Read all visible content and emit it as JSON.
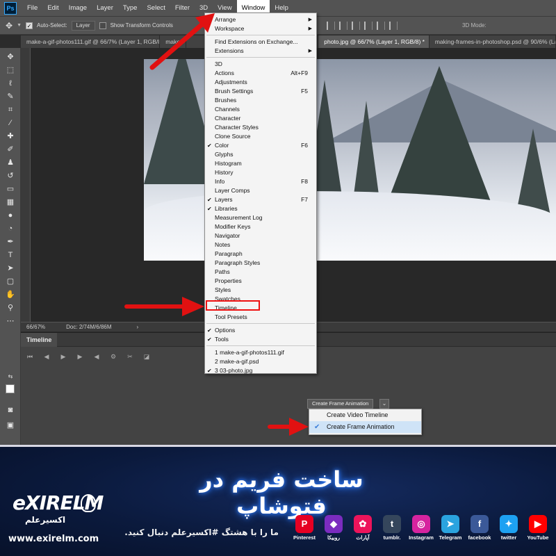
{
  "app": {
    "logo": "Ps",
    "menus": [
      "File",
      "Edit",
      "Image",
      "Layer",
      "Type",
      "Select",
      "Filter",
      "3D",
      "View",
      "Window",
      "Help"
    ],
    "active_menu": "Window"
  },
  "options_bar": {
    "auto_select_label": "Auto-Select:",
    "auto_select_value": "Layer",
    "show_transform_label": "Show Transform Controls",
    "mode_3d_label": "3D Mode:"
  },
  "doc_tabs": [
    {
      "label": "make-a-gif-photos111.gif @ 66/7% (Layer 1, RGB/8) *"
    },
    {
      "label": "make"
    },
    {
      "label": "photo.jpg @ 66/7% (Layer 1, RGB/8) *"
    },
    {
      "label": "making-frames-in-photoshop.psd @ 90/6% (Layer 1, R"
    }
  ],
  "status_bar": {
    "zoom": "66/67%",
    "doc_info": "Doc: 2/74M/6/86M"
  },
  "timeline": {
    "title": "Timeline",
    "create_button": "Create Frame Animation",
    "dropdown_options": [
      {
        "label": "Create Video Timeline",
        "selected": false
      },
      {
        "label": "Create Frame Animation",
        "selected": true
      }
    ]
  },
  "window_menu": {
    "items": [
      {
        "label": "Arrange",
        "shortcut": "",
        "checked": false,
        "submenu": true,
        "sep_after": false
      },
      {
        "label": "Workspace",
        "shortcut": "",
        "checked": false,
        "submenu": true,
        "sep_after": true
      },
      {
        "label": "Find Extensions on Exchange...",
        "shortcut": "",
        "checked": false,
        "submenu": false,
        "sep_after": false
      },
      {
        "label": "Extensions",
        "shortcut": "",
        "checked": false,
        "submenu": true,
        "sep_after": true
      },
      {
        "label": "3D",
        "shortcut": "",
        "checked": false,
        "submenu": false,
        "sep_after": false
      },
      {
        "label": "Actions",
        "shortcut": "Alt+F9",
        "checked": false,
        "submenu": false,
        "sep_after": false
      },
      {
        "label": "Adjustments",
        "shortcut": "",
        "checked": false,
        "submenu": false,
        "sep_after": false
      },
      {
        "label": "Brush Settings",
        "shortcut": "F5",
        "checked": false,
        "submenu": false,
        "sep_after": false
      },
      {
        "label": "Brushes",
        "shortcut": "",
        "checked": false,
        "submenu": false,
        "sep_after": false
      },
      {
        "label": "Channels",
        "shortcut": "",
        "checked": false,
        "submenu": false,
        "sep_after": false
      },
      {
        "label": "Character",
        "shortcut": "",
        "checked": false,
        "submenu": false,
        "sep_after": false
      },
      {
        "label": "Character Styles",
        "shortcut": "",
        "checked": false,
        "submenu": false,
        "sep_after": false
      },
      {
        "label": "Clone Source",
        "shortcut": "",
        "checked": false,
        "submenu": false,
        "sep_after": false
      },
      {
        "label": "Color",
        "shortcut": "F6",
        "checked": true,
        "submenu": false,
        "sep_after": false
      },
      {
        "label": "Glyphs",
        "shortcut": "",
        "checked": false,
        "submenu": false,
        "sep_after": false
      },
      {
        "label": "Histogram",
        "shortcut": "",
        "checked": false,
        "submenu": false,
        "sep_after": false
      },
      {
        "label": "History",
        "shortcut": "",
        "checked": false,
        "submenu": false,
        "sep_after": false
      },
      {
        "label": "Info",
        "shortcut": "F8",
        "checked": false,
        "submenu": false,
        "sep_after": false
      },
      {
        "label": "Layer Comps",
        "shortcut": "",
        "checked": false,
        "submenu": false,
        "sep_after": false
      },
      {
        "label": "Layers",
        "shortcut": "F7",
        "checked": true,
        "submenu": false,
        "sep_after": false
      },
      {
        "label": "Libraries",
        "shortcut": "",
        "checked": true,
        "submenu": false,
        "sep_after": false
      },
      {
        "label": "Measurement Log",
        "shortcut": "",
        "checked": false,
        "submenu": false,
        "sep_after": false
      },
      {
        "label": "Modifier Keys",
        "shortcut": "",
        "checked": false,
        "submenu": false,
        "sep_after": false
      },
      {
        "label": "Navigator",
        "shortcut": "",
        "checked": false,
        "submenu": false,
        "sep_after": false
      },
      {
        "label": "Notes",
        "shortcut": "",
        "checked": false,
        "submenu": false,
        "sep_after": false
      },
      {
        "label": "Paragraph",
        "shortcut": "",
        "checked": false,
        "submenu": false,
        "sep_after": false
      },
      {
        "label": "Paragraph Styles",
        "shortcut": "",
        "checked": false,
        "submenu": false,
        "sep_after": false
      },
      {
        "label": "Paths",
        "shortcut": "",
        "checked": false,
        "submenu": false,
        "sep_after": false
      },
      {
        "label": "Properties",
        "shortcut": "",
        "checked": false,
        "submenu": false,
        "sep_after": false
      },
      {
        "label": "Styles",
        "shortcut": "",
        "checked": false,
        "submenu": false,
        "sep_after": false
      },
      {
        "label": "Swatches",
        "shortcut": "",
        "checked": false,
        "submenu": false,
        "sep_after": false
      },
      {
        "label": "Timeline",
        "shortcut": "",
        "checked": false,
        "submenu": false,
        "sep_after": false
      },
      {
        "label": "Tool Presets",
        "shortcut": "",
        "checked": false,
        "submenu": false,
        "sep_after": true
      },
      {
        "label": "Options",
        "shortcut": "",
        "checked": true,
        "submenu": false,
        "sep_after": false
      },
      {
        "label": "Tools",
        "shortcut": "",
        "checked": true,
        "submenu": false,
        "sep_after": true
      },
      {
        "label": "1 make-a-gif-photos111.gif",
        "shortcut": "",
        "checked": false,
        "submenu": false,
        "sep_after": false
      },
      {
        "label": "2 make-a-gif.psd",
        "shortcut": "",
        "checked": false,
        "submenu": false,
        "sep_after": false
      },
      {
        "label": "3 03-photo.jpg",
        "shortcut": "",
        "checked": true,
        "submenu": false,
        "sep_after": false
      }
    ]
  },
  "banner": {
    "title": "ساخت فریم در فتوشاپ",
    "subtitle": "ما را با هشتگ #اکسیرعلم دنبال کنید.",
    "logo_text": "eXIRELM",
    "logo_fa": "اکسیرعلم",
    "url": "www.exirelm.com",
    "socials": [
      {
        "icon": "pinterest-icon",
        "glyph": "P",
        "label": "Pinterest",
        "color": "#e60023"
      },
      {
        "icon": "rubika-icon",
        "glyph": "◆",
        "label": "روبیکا",
        "color": "#7b2cbf"
      },
      {
        "icon": "aparat-icon",
        "glyph": "✿",
        "label": "آپارات",
        "color": "#ed145b"
      },
      {
        "icon": "tumblr-icon",
        "glyph": "t",
        "label": "tumblr.",
        "color": "#35465c"
      },
      {
        "icon": "instagram-icon",
        "glyph": "◎",
        "label": "Instagram",
        "color": "#d6249f"
      },
      {
        "icon": "telegram-icon",
        "glyph": "➤",
        "label": "Telegram",
        "color": "#2aa3df"
      },
      {
        "icon": "facebook-icon",
        "glyph": "f",
        "label": "facebook",
        "color": "#3b5998"
      },
      {
        "icon": "twitter-icon",
        "glyph": "✦",
        "label": "twitter",
        "color": "#1da1f2"
      },
      {
        "icon": "youtube-icon",
        "glyph": "▶",
        "label": "YouTube",
        "color": "#ff0000"
      }
    ]
  },
  "colors": {
    "annotation_red": "#e11111",
    "menu_bg": "#f4f4f4",
    "ui_dark": "#535353"
  }
}
